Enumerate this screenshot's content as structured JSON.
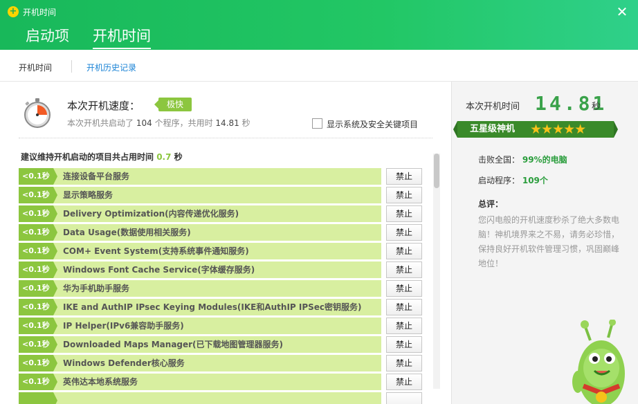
{
  "window": {
    "title": "开机时间"
  },
  "main_tabs": [
    {
      "label": "启动项"
    },
    {
      "label": "开机时间"
    }
  ],
  "sub_tabs": [
    {
      "label": "开机时间"
    },
    {
      "label": "开机历史记录"
    }
  ],
  "speed": {
    "label": "本次开机速度：",
    "badge": "极快",
    "summary_prefix": "本次开机共启动了",
    "program_count": "104",
    "summary_mid": "个程序，共用时",
    "total_time": "14.81",
    "summary_unit": "秒"
  },
  "show_system_items": {
    "label": "显示系统及安全关键项目",
    "checked": false
  },
  "recommend": {
    "prefix": "建议维持开机启动的项目共占用时间",
    "time": "0.7",
    "unit": "秒"
  },
  "items": [
    {
      "time": "<0.1秒",
      "name": "连接设备平台服务",
      "button": "禁止"
    },
    {
      "time": "<0.1秒",
      "name": "显示策略服务",
      "button": "禁止"
    },
    {
      "time": "<0.1秒",
      "name": "Delivery Optimization(内容传递优化服务)",
      "button": "禁止"
    },
    {
      "time": "<0.1秒",
      "name": "Data Usage(数据使用相关服务)",
      "button": "禁止"
    },
    {
      "time": "<0.1秒",
      "name": "COM+ Event System(支持系统事件通知服务)",
      "button": "禁止"
    },
    {
      "time": "<0.1秒",
      "name": "Windows Font Cache Service(字体缓存服务)",
      "button": "禁止"
    },
    {
      "time": "<0.1秒",
      "name": "华为手机助手服务",
      "button": "禁止"
    },
    {
      "time": "<0.1秒",
      "name": "IKE and AuthIP IPsec Keying Modules(IKE和AuthIP IPSec密钥服务)",
      "button": "禁止"
    },
    {
      "time": "<0.1秒",
      "name": "IP Helper(IPv6兼容助手服务)",
      "button": "禁止"
    },
    {
      "time": "<0.1秒",
      "name": "Downloaded Maps Manager(已下载地图管理器服务)",
      "button": "禁止"
    },
    {
      "time": "<0.1秒",
      "name": "Windows Defender核心服务",
      "button": "禁止"
    },
    {
      "time": "<0.1秒",
      "name": "英伟达本地系统服务",
      "button": "禁止"
    },
    {
      "time": "",
      "name": "",
      "button": ""
    }
  ],
  "right": {
    "boot_time_label": "本次开机时间",
    "boot_time_value": "14.81",
    "boot_time_unit": "秒",
    "rank": "五星级神机",
    "stars": "★★★★★",
    "beat_label": "击败全国：",
    "beat_value": "99%的电脑",
    "programs_label": "启动程序：",
    "programs_value": "109个",
    "comment_title": "总评：",
    "comment": "您闪电般的开机速度秒杀了绝大多数电脑！神机境界来之不易，请务必珍惜，保持良好开机软件管理习惯，巩固巅峰地位！"
  },
  "colors": {
    "header": "#22c765",
    "accent_green": "#8cc63f",
    "row_bg": "#d8efa0",
    "link_blue": "#1a83d6"
  }
}
